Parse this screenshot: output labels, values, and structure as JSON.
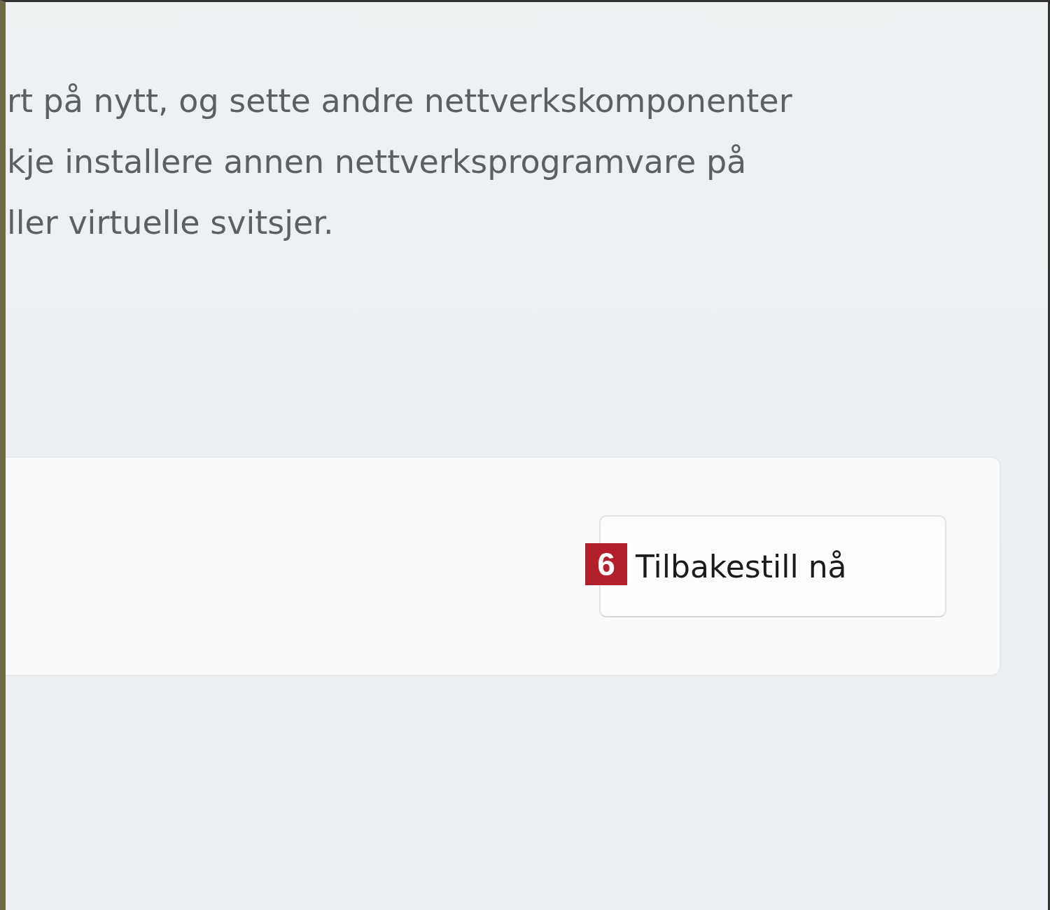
{
  "description_lines": [
    "rt på nytt, og sette andre nettverkskomponenter",
    "kje installere annen nettverksprogramvare på",
    "ller virtuelle svitsjer."
  ],
  "reset_card": {
    "button": {
      "label": "Tilbakestill nå"
    },
    "badge": "6"
  }
}
